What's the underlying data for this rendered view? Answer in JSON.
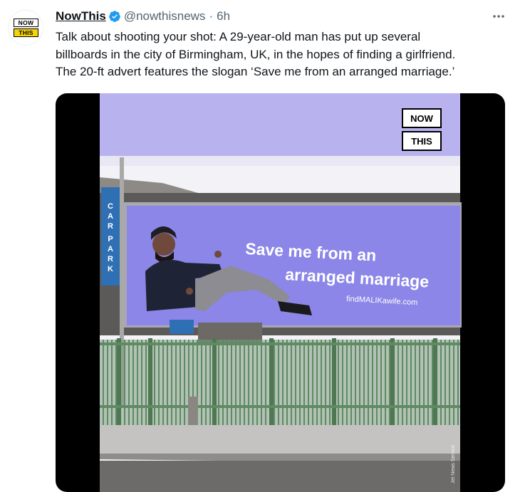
{
  "author": {
    "display_name": "NowThis",
    "handle": "@nowthisnews",
    "separator": "·",
    "time": "6h",
    "avatar_logo": {
      "line1": "NOW",
      "line2": "THIS"
    },
    "verified_color": "#1d9bf0"
  },
  "tweet": {
    "lines": [
      "Talk about shooting your shot: A 29-year-old man has put up several",
      "billboards in the city of Birmingham, UK, in the hopes of finding a girlfriend.",
      "The 20-ft advert features the slogan ‘Save me from an arranged marriage.’"
    ]
  },
  "media": {
    "watermark": {
      "line1": "NOW",
      "line2": "THIS"
    },
    "billboard": {
      "headline_line1": "Save me from an",
      "headline_line2": "arranged marriage",
      "url": "findMALIKawife.com"
    },
    "car_park_sign": [
      "C",
      "A",
      "R",
      "P",
      "A",
      "R",
      "K"
    ],
    "side_credit": "Jet News Service"
  },
  "colors": {
    "billboard_bg": "#8b86e8",
    "sky": "#f3f2f7",
    "fence": "#5f8a63",
    "car_park_sign": "#2f6fb3"
  }
}
